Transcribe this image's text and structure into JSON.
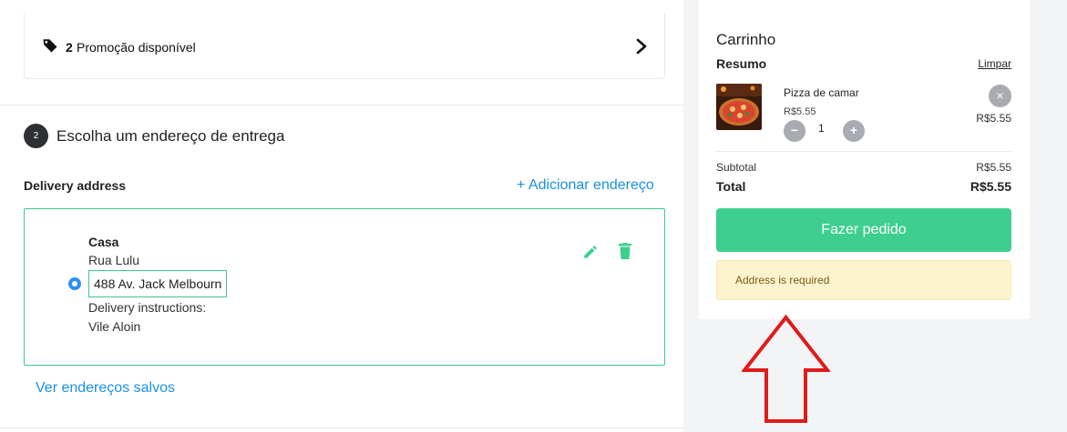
{
  "promo": {
    "count": "2",
    "text": "Promoção disponível",
    "tag_icon": "tag-icon",
    "chevron_icon": "chevron-right-icon"
  },
  "step": {
    "number": "2",
    "title": "Escolha um endereço de entrega"
  },
  "delivery": {
    "label": "Delivery address",
    "add_link": "+ Adicionar endereço",
    "address": {
      "name": "Casa",
      "street": "Rua Lulu",
      "number": "488 Av. Jack Melbourn",
      "instructions_label": "Delivery instructions:",
      "instructions_value": "Vile Aloin",
      "selected": true
    },
    "saved_link": "Ver endereços salvos"
  },
  "cart": {
    "title": "Carrinho",
    "summary_label": "Resumo",
    "clear_label": "Limpar",
    "items": [
      {
        "name": "Pizza de camar",
        "unit_price": "R$5.55",
        "quantity": "1",
        "total": "R$5.55"
      }
    ],
    "remove_icon": "×",
    "minus_icon": "−",
    "plus_icon": "+",
    "subtotal_label": "Subtotal",
    "subtotal_value": "R$5.55",
    "total_label": "Total",
    "total_value": "R$5.55",
    "order_button": "Fazer pedido",
    "alert": "Address is required"
  },
  "colors": {
    "accent_green": "#3ecf8e",
    "link_blue": "#1a8fe3",
    "alert_bg": "#fdf3cf",
    "annotation_red": "#e01b1b"
  }
}
